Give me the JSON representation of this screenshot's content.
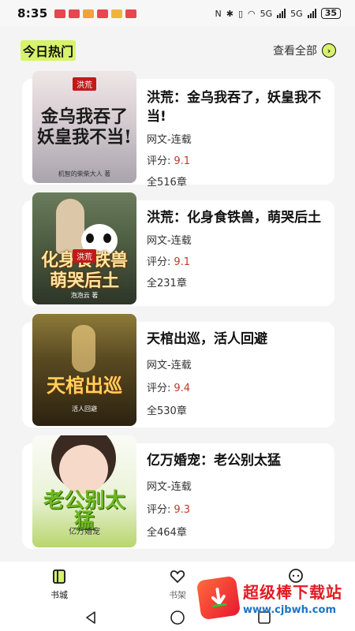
{
  "status_bar": {
    "time": "8:35",
    "network_1": "5G",
    "network_2": "5G",
    "battery": "35"
  },
  "section": {
    "title": "今日热门",
    "see_all": "查看全部"
  },
  "books": [
    {
      "title": "洪荒：金乌我吞了，妖皇我不当!",
      "category": "网文-连载",
      "score_label": "评分:",
      "score": "9.1",
      "chapters": "全516章",
      "cover_tag": "洪荒",
      "cover_title": "金乌我吞了 妖皇我不当!",
      "cover_author": "机智的柴柴大人 著"
    },
    {
      "title": "洪荒：化身食铁兽，萌哭后土",
      "category": "网文-连载",
      "score_label": "评分:",
      "score": "9.1",
      "chapters": "全231章",
      "cover_tag": "洪荒",
      "cover_title": "化身食铁兽 萌哭后土",
      "cover_author": "泡泡云 著"
    },
    {
      "title": "天棺出巡，活人回避",
      "category": "网文-连载",
      "score_label": "评分:",
      "score": "9.4",
      "chapters": "全530章",
      "cover_tag": "",
      "cover_title": "天棺出巡",
      "cover_author": "活人回避"
    },
    {
      "title": "亿万婚宠：老公别太猛",
      "category": "网文-连载",
      "score_label": "评分:",
      "score": "9.3",
      "chapters": "全464章",
      "cover_tag": "",
      "cover_title": "老公别太猛",
      "cover_author": "亿万婚宠"
    }
  ],
  "bottom_nav": [
    {
      "label": "书城",
      "icon": "book-city-icon"
    },
    {
      "label": "书架",
      "icon": "heart-icon"
    },
    {
      "label": "",
      "icon": "chat-icon"
    }
  ],
  "watermark": {
    "name": "超级棒下载站",
    "url": "www.cjbwh.com"
  },
  "colors": {
    "accent": "#d7f26b",
    "score": "#c0392b",
    "watermark_red": "#e21b23",
    "watermark_blue": "#1a73c9"
  }
}
